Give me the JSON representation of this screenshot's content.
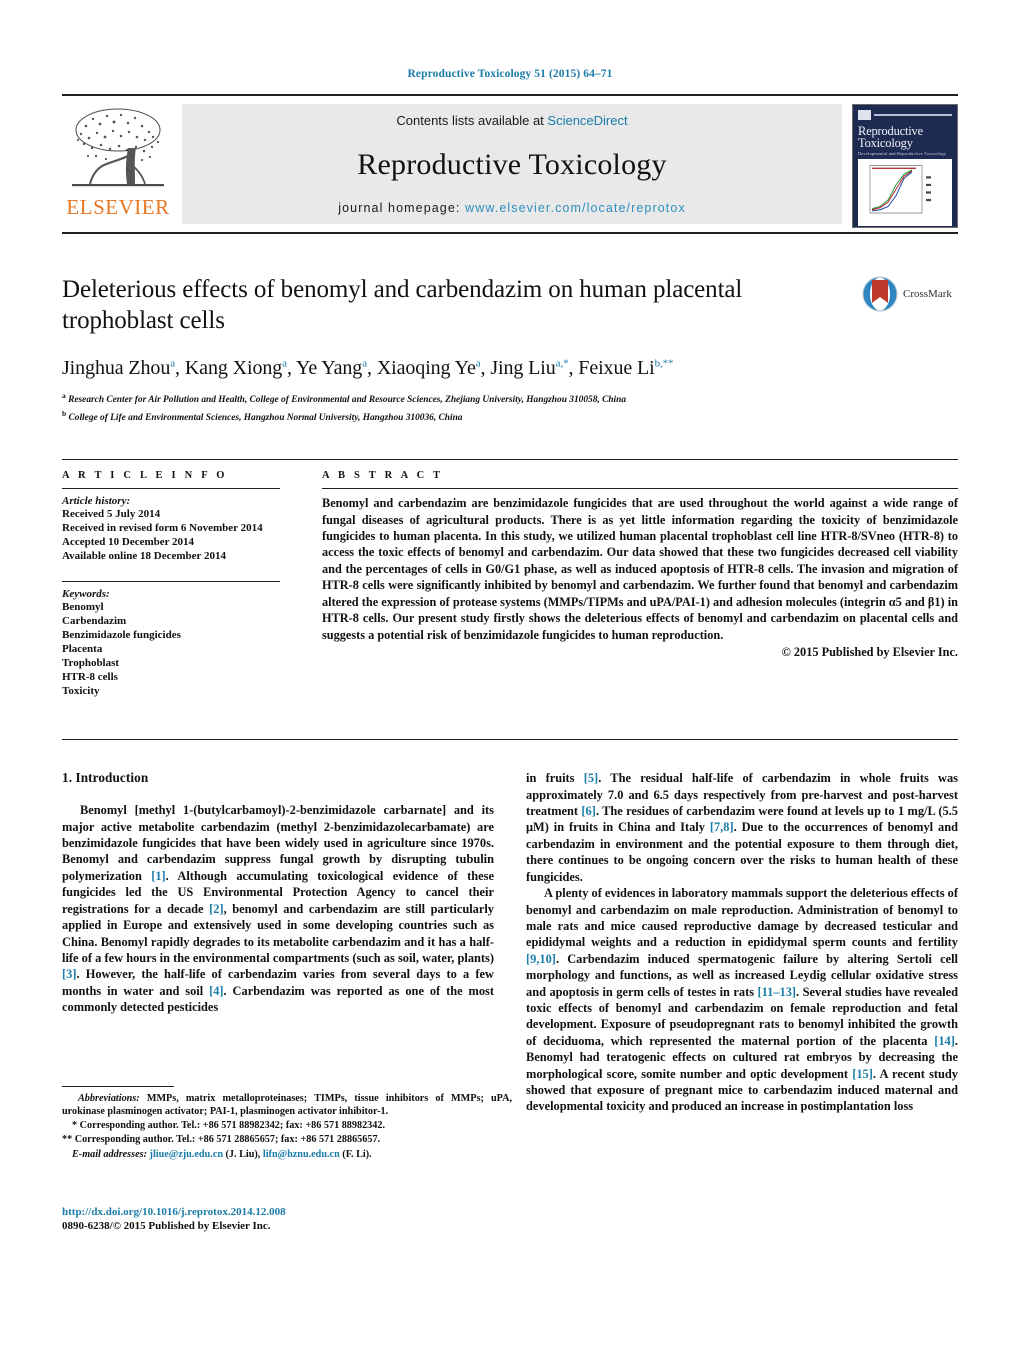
{
  "running_head": "Reproductive Toxicology 51 (2015) 64–71",
  "masthead": {
    "contents_prefix": "Contents lists available at ",
    "sciencedirect": "ScienceDirect",
    "journal_title": "Reproductive Toxicology",
    "homepage_label": "journal homepage:",
    "homepage_url": "www.elsevier.com/locate/reprotox",
    "publisher_wordmark": "ELSEVIER",
    "cover": {
      "title_line1": "Reproductive",
      "title_line2": "Toxicology",
      "subtitle": "Developmental and Reproductive Toxicology"
    },
    "colors": {
      "link": "#1a7ca8",
      "homepage_link": "#2e8fc0",
      "elsevier_orange": "#e87722",
      "panel_bg": "#e9e9e9",
      "cover_bg": "#1d2a52"
    }
  },
  "article": {
    "title": "Deleterious effects of benomyl and carbendazim on human placental trophoblast cells",
    "crossmark_label": "CrossMark",
    "authors_html": "Jinghua Zhou<sup>a</sup>, Kang Xiong<sup>a</sup>, Ye Yang<sup>a</sup>, Xiaoqing Ye<sup>a</sup>, Jing Liu<sup>a,*</sup>, Feixue Li<sup>b,**</sup>",
    "affiliation_a": "Research Center for Air Pollution and Health, College of Environmental and Resource Sciences, Zhejiang University, Hangzhou 310058, China",
    "affiliation_b": "College of Life and Environmental Sciences, Hangzhou Normal University, Hangzhou 310036, China"
  },
  "article_info": {
    "heading": "A R T I C L E   I N F O",
    "history_label": "Article history:",
    "history": [
      "Received 5 July 2014",
      "Received in revised form 6 November 2014",
      "Accepted 10 December 2014",
      "Available online 18 December 2014"
    ],
    "keywords_label": "Keywords:",
    "keywords": [
      "Benomyl",
      "Carbendazim",
      "Benzimidazole fungicides",
      "Placenta",
      "Trophoblast",
      "HTR-8 cells",
      "Toxicity"
    ]
  },
  "abstract": {
    "heading": "A B S T R A C T",
    "text": "Benomyl and carbendazim are benzimidazole fungicides that are used throughout the world against a wide range of fungal diseases of agricultural products. There is as yet little information regarding the toxicity of benzimidazole fungicides to human placenta. In this study, we utilized human placental trophoblast cell line HTR-8/SVneo (HTR-8) to access the toxic effects of benomyl and carbendazim. Our data showed that these two fungicides decreased cell viability and the percentages of cells in G0/G1 phase, as well as induced apoptosis of HTR-8 cells. The invasion and migration of HTR-8 cells were significantly inhibited by benomyl and carbendazim. We further found that benomyl and carbendazim altered the expression of protease systems (MMPs/TIPMs and uPA/PAI-1) and adhesion molecules (integrin α5 and β1) in HTR-8 cells. Our present study firstly shows the deleterious effects of benomyl and carbendazim on placental cells and suggests a potential risk of benzimidazole fungicides to human reproduction.",
    "copyright": "© 2015 Published by Elsevier Inc."
  },
  "body": {
    "section_number_title": "1.  Introduction",
    "left_paragraphs": [
      "Benomyl [methyl 1-(butylcarbamoyl)-2-benzimidazole carbarnate] and its major active metabolite carbendazim (methyl 2-benzimidazolecarbamate) are benzimidazole fungicides that have been widely used in agriculture since 1970s. Benomyl and carbendazim suppress fungal growth by disrupting tubulin polymerization [1]. Although accumulating toxicological evidence of these fungicides led the US Environmental Protection Agency to cancel their registrations for a decade [2], benomyl and carbendazim are still particularly applied in Europe and extensively used in some developing countries such as China. Benomyl rapidly degrades to its metabolite carbendazim and it has a half-life of a few hours in the environmental compartments (such as soil, water, plants) [3]. However, the half-life of carbendazim varies from several days to a few months in water and soil [4]. Carbendazim was reported as one of the most commonly detected pesticides"
    ],
    "right_paragraphs": [
      "in fruits [5]. The residual half-life of carbendazim in whole fruits was approximately 7.0 and 6.5 days respectively from pre-harvest and post-harvest treatment [6]. The residues of carbendazim were found at levels up to 1 mg/L (5.5 μM) in fruits in China and Italy [7,8]. Due to the occurrences of benomyl and carbendazim in environment and the potential exposure to them through diet, there continues to be ongoing concern over the risks to human health of these fungicides.",
      "A plenty of evidences in laboratory mammals support the deleterious effects of benomyl and carbendazim on male reproduction. Administration of benomyl to male rats and mice caused reproductive damage by decreased testicular and epididymal weights and a reduction in epididymal sperm counts and fertility [9,10]. Carbendazim induced spermatogenic failure by altering Sertoli cell morphology and functions, as well as increased Leydig cellular oxidative stress and apoptosis in germ cells of testes in rats [11–13]. Several studies have revealed toxic effects of benomyl and carbendazim on female reproduction and fetal development. Exposure of pseudopregnant rats to benomyl inhibited the growth of deciduoma, which represented the maternal portion of the placenta [14]. Benomyl had teratogenic effects on cultured rat embryos by decreasing the morphological score, somite number and optic development [15]. A recent study showed that exposure of pregnant mice to carbendazim induced maternal and developmental toxicity and produced an increase in postimplantation loss"
    ]
  },
  "footnotes": {
    "abbreviations_label": "Abbreviations:",
    "abbreviations_text": " MMPs, matrix metalloproteinases; TIMPs, tissue inhibitors of MMPs; uPA, urokinase plasminogen activator; PAI-1, plasminogen activator inhibitor-1.",
    "corresponding_1": "* Corresponding author. Tel.: +86 571 88982342; fax: +86 571 88982342.",
    "corresponding_2": "** Corresponding author. Tel.: +86 571 28865657; fax: +86 571 28865657.",
    "email_label": "E-mail addresses:",
    "email_1": "jliue@zju.edu.cn",
    "email_1_owner": "(J. Liu),",
    "email_2": "lifn@hznu.edu.cn",
    "email_2_owner": "(F. Li)."
  },
  "footer": {
    "doi": "http://dx.doi.org/10.1016/j.reprotox.2014.12.008",
    "issn_line": "0890-6238/© 2015 Published by Elsevier Inc."
  }
}
